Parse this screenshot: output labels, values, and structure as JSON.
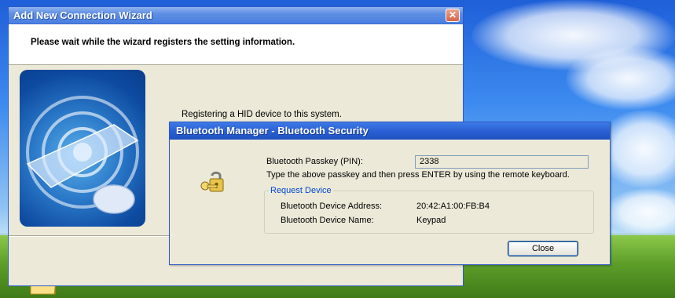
{
  "wizard": {
    "title": "Add New Connection Wizard",
    "header": "Please wait while the wizard registers the setting information.",
    "status": "Registering a HID device to this system."
  },
  "bluetooth_dialog": {
    "title": "Bluetooth Manager - Bluetooth Security",
    "passkey_label": "Bluetooth Passkey (PIN):",
    "passkey_value": "2338",
    "instruction": "Type the above passkey and then press ENTER by using the remote keyboard.",
    "group_title": "Request Device",
    "address_label": "Bluetooth Device Address:",
    "address_value": "20:42:A1:00:FB:B4",
    "name_label": "Bluetooth Device Name:",
    "name_value": "Keypad",
    "close_label": "Close"
  },
  "icons": {
    "wizard_close": "close-icon",
    "security": "key-lock-icon",
    "desktop": "folder-icon"
  },
  "colors": {
    "titlebar": "#2a60d4",
    "dialog_bg": "#ece9d8",
    "group_title": "#0046d5"
  }
}
